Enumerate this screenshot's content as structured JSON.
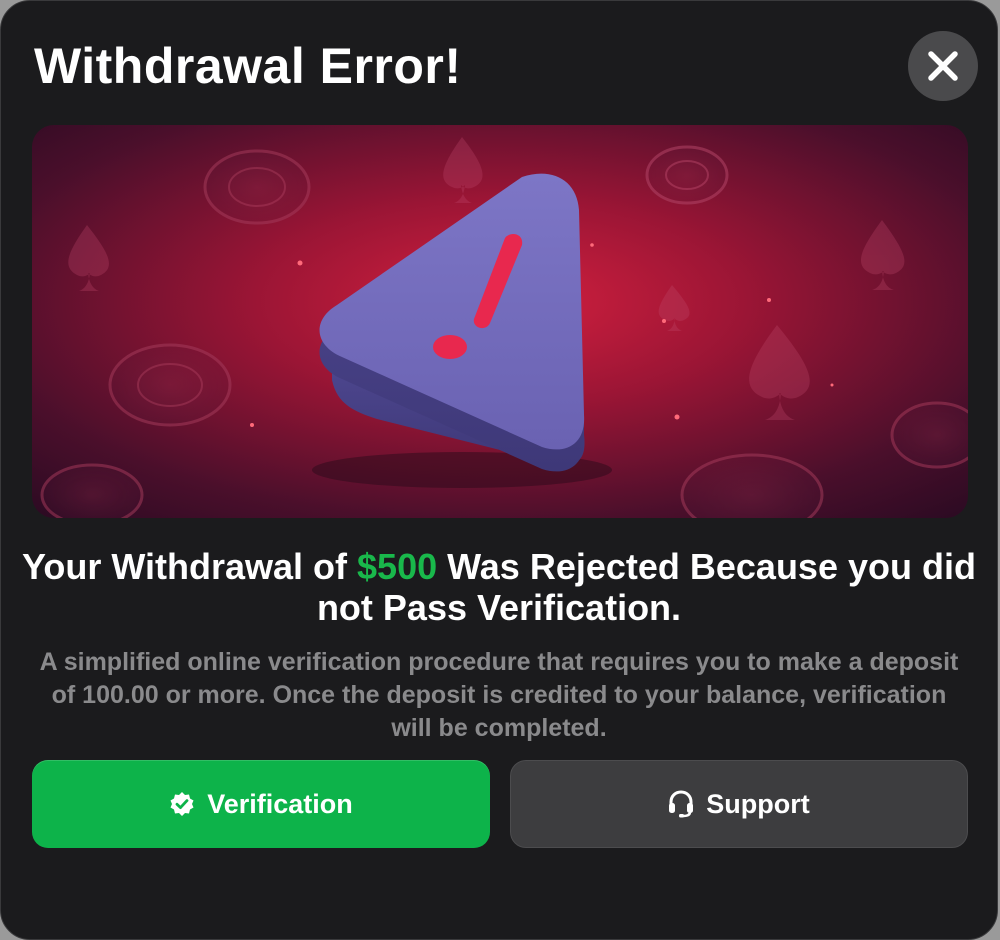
{
  "modal": {
    "title": "Withdrawal Error!",
    "close_icon": "close-icon"
  },
  "hero": {
    "image_icon": "warning-triangle-icon",
    "colors": {
      "background": "#7a1030",
      "triangle": "#6f66b8",
      "mark": "#e8284e"
    }
  },
  "message": {
    "headline_before": "Your Withdrawal of ",
    "amount": "$500",
    "headline_after": " Was Rejected Because you did not Pass Verification.",
    "description": "A simplified online verification procedure that requires you to make a deposit of 100.00 or more. Once the deposit is credited to your balance, verification will be completed."
  },
  "actions": {
    "verify_label": "Verification",
    "verify_icon": "verified-badge-icon",
    "support_label": "Support",
    "support_icon": "headset-icon"
  },
  "colors": {
    "accent_green": "#19b84b",
    "modal_bg": "#1b1b1d",
    "secondary_button": "#3d3d3f"
  }
}
